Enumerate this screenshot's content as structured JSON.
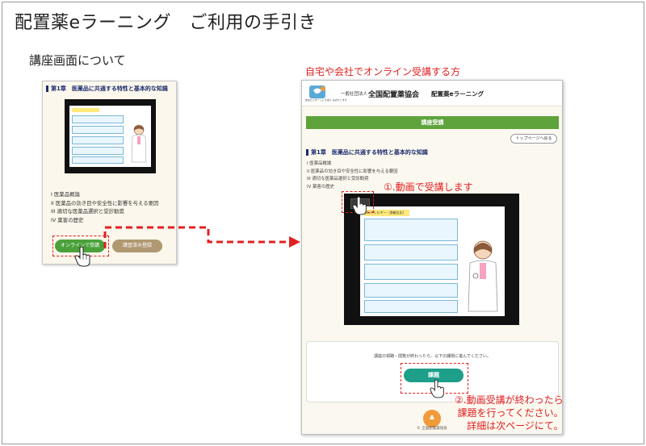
{
  "title": "配置薬eラーニング　ご利用の手引き",
  "section_title": "講座画面について",
  "online_heading": "自宅や会社でオンライン受講する方",
  "left_panel": {
    "chapter_title": "第1章　医薬品に共通する特性と基本的な知識",
    "menu_items": [
      "I 医薬品概論",
      "II 医薬品の効き目や安全性に影響を与える要因",
      "III 適切な医薬品選択と受診勧奨",
      "IV 薬害の歴史"
    ],
    "online_button": "オンラインで受講",
    "finished_button": "講習済み登録"
  },
  "right_panel": {
    "org_small": "一般社団法人",
    "org_name": "全国配置薬協会",
    "site_name": "配置薬eラーニング",
    "logo_text": "あなたとずーっとそばに みのりくすり",
    "green_bar": "講座受講",
    "top_page_button": "トップページへ戻る",
    "chapter_title": "第1章　医薬品に共通する特性と基本的な知識",
    "menu_items": [
      "I 医薬品概論",
      "II 医薬品の効き目や安全性に影響を与える要因",
      "III 適切な医薬品選択と受診勧奨",
      "IV 薬害の歴史"
    ],
    "slide_title": "(1)アレルギー（過敏反応）",
    "notice": "講座の視聴・閲覧が終わったら、以下の課題に進んでください。",
    "task_button": "課題",
    "copyright": "© 全国配置薬協会"
  },
  "annotations": {
    "step1": "①.動画で受講します",
    "step2_lines": [
      "②.動画受講が終わったら",
      "課題を行ってください。",
      "詳細は次ページにて。"
    ]
  },
  "colors": {
    "accent_red": "#e02020",
    "green": "#5ea33c",
    "teal": "#1e9f8a",
    "navy": "#1a2a6c"
  },
  "icons": [
    "hand-pointer-icon",
    "play-icon",
    "up-arrow-icon",
    "logo-icon"
  ]
}
